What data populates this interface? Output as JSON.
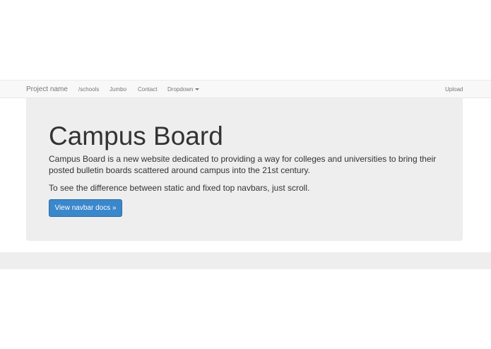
{
  "navbar": {
    "brand": "Project name",
    "links": [
      {
        "label": "/schools"
      },
      {
        "label": "Jumbo"
      },
      {
        "label": "Contact"
      },
      {
        "label": "Dropdown"
      }
    ],
    "right_link": "Upload"
  },
  "jumbotron": {
    "title": "Campus Board",
    "description": "Campus Board is a new website dedicated to providing a way for colleges and universities to bring their posted bulletin boards scattered around campus into the 21st century.",
    "note": "To see the difference between static and fixed top navbars, just scroll.",
    "button_label": "View navbar docs »"
  },
  "colors": {
    "navbar_bg": "#f8f8f8",
    "jumbotron_bg": "#eeeeee",
    "primary_button": "#3a87cc",
    "nav_text": "#777777"
  }
}
